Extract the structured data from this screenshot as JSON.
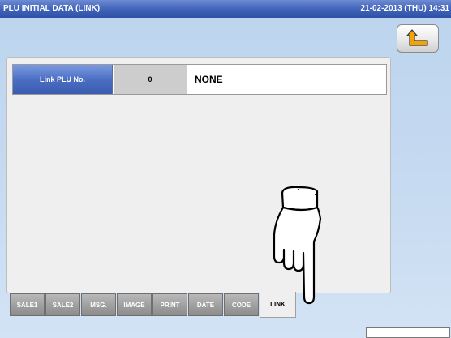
{
  "header": {
    "title": "PLU INITIAL DATA (LINK)",
    "datetime": "21-02-2013 (THU)  14:31"
  },
  "back_button": {
    "icon": "back-arrow-icon"
  },
  "link_field": {
    "label": "Link PLU No.",
    "value": "0",
    "name": "NONE"
  },
  "tabs": [
    {
      "label": "SALE1"
    },
    {
      "label": "SALE2"
    },
    {
      "label": "MSG."
    },
    {
      "label": "IMAGE"
    },
    {
      "label": "PRINT"
    },
    {
      "label": "DATE"
    },
    {
      "label": "CODE"
    },
    {
      "label": "LINK",
      "active": true
    }
  ],
  "colors": {
    "title_bar": "#3f62b8",
    "label_blue": "#4b6fc4",
    "tab_gray": "#9f9f9f",
    "background": "#c7dbf1"
  },
  "pointer_icon": "pointing-hand-icon"
}
